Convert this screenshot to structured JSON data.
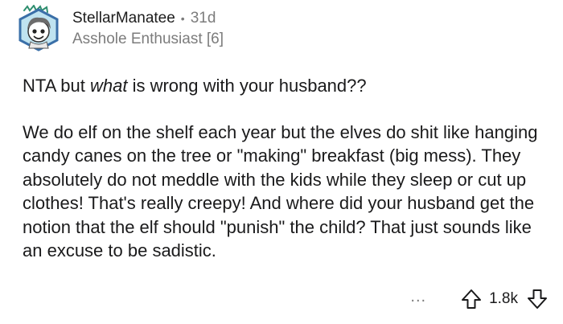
{
  "comment": {
    "author": "StellarManatee",
    "separator": "•",
    "age": "31d",
    "flair": "Asshole Enthusiast [6]",
    "body": {
      "line1_prefix": "NTA but ",
      "line1_emphasis": "what",
      "line1_suffix": " is wrong with your husband??",
      "paragraph2": "We do elf on the shelf each year but the elves do shit like hanging candy canes on the tree or \"making\" breakfast (big mess). They absolutely do not meddle with the kids while they sleep or cut up clothes! That's really creepy! And where did your husband get the notion that the elf should \"punish\" the child? That just sounds like an excuse to be sadistic."
    },
    "actions": {
      "more_label": "...",
      "score": "1.8k"
    }
  },
  "icons": {
    "avatar": "snoo-avatar-icon",
    "upvote": "upvote-arrow-icon",
    "downvote": "downvote-arrow-icon"
  },
  "colors": {
    "avatar_bg": "#bfe3f0",
    "avatar_border": "#3a6fa8",
    "muted_text": "#7c7c7c"
  }
}
